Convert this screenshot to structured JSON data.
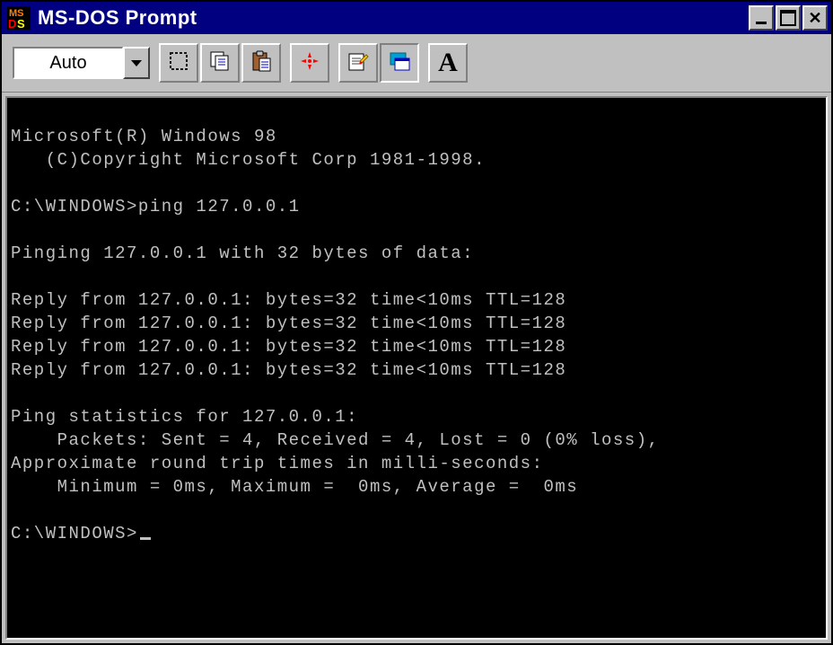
{
  "window": {
    "title": "MS-DOS Prompt"
  },
  "toolbar": {
    "font_size": "Auto",
    "buttons": {
      "mark": "mark",
      "copy": "copy",
      "paste": "paste",
      "fullscreen": "fullscreen",
      "properties": "properties",
      "background": "background",
      "font": "font"
    }
  },
  "terminal": {
    "lines": [
      "Microsoft(R) Windows 98",
      "   (C)Copyright Microsoft Corp 1981-1998.",
      "",
      "C:\\WINDOWS>ping 127.0.0.1",
      "",
      "Pinging 127.0.0.1 with 32 bytes of data:",
      "",
      "Reply from 127.0.0.1: bytes=32 time<10ms TTL=128",
      "Reply from 127.0.0.1: bytes=32 time<10ms TTL=128",
      "Reply from 127.0.0.1: bytes=32 time<10ms TTL=128",
      "Reply from 127.0.0.1: bytes=32 time<10ms TTL=128",
      "",
      "Ping statistics for 127.0.0.1:",
      "    Packets: Sent = 4, Received = 4, Lost = 0 (0% loss),",
      "Approximate round trip times in milli-seconds:",
      "    Minimum = 0ms, Maximum =  0ms, Average =  0ms",
      ""
    ],
    "prompt": "C:\\WINDOWS>"
  }
}
